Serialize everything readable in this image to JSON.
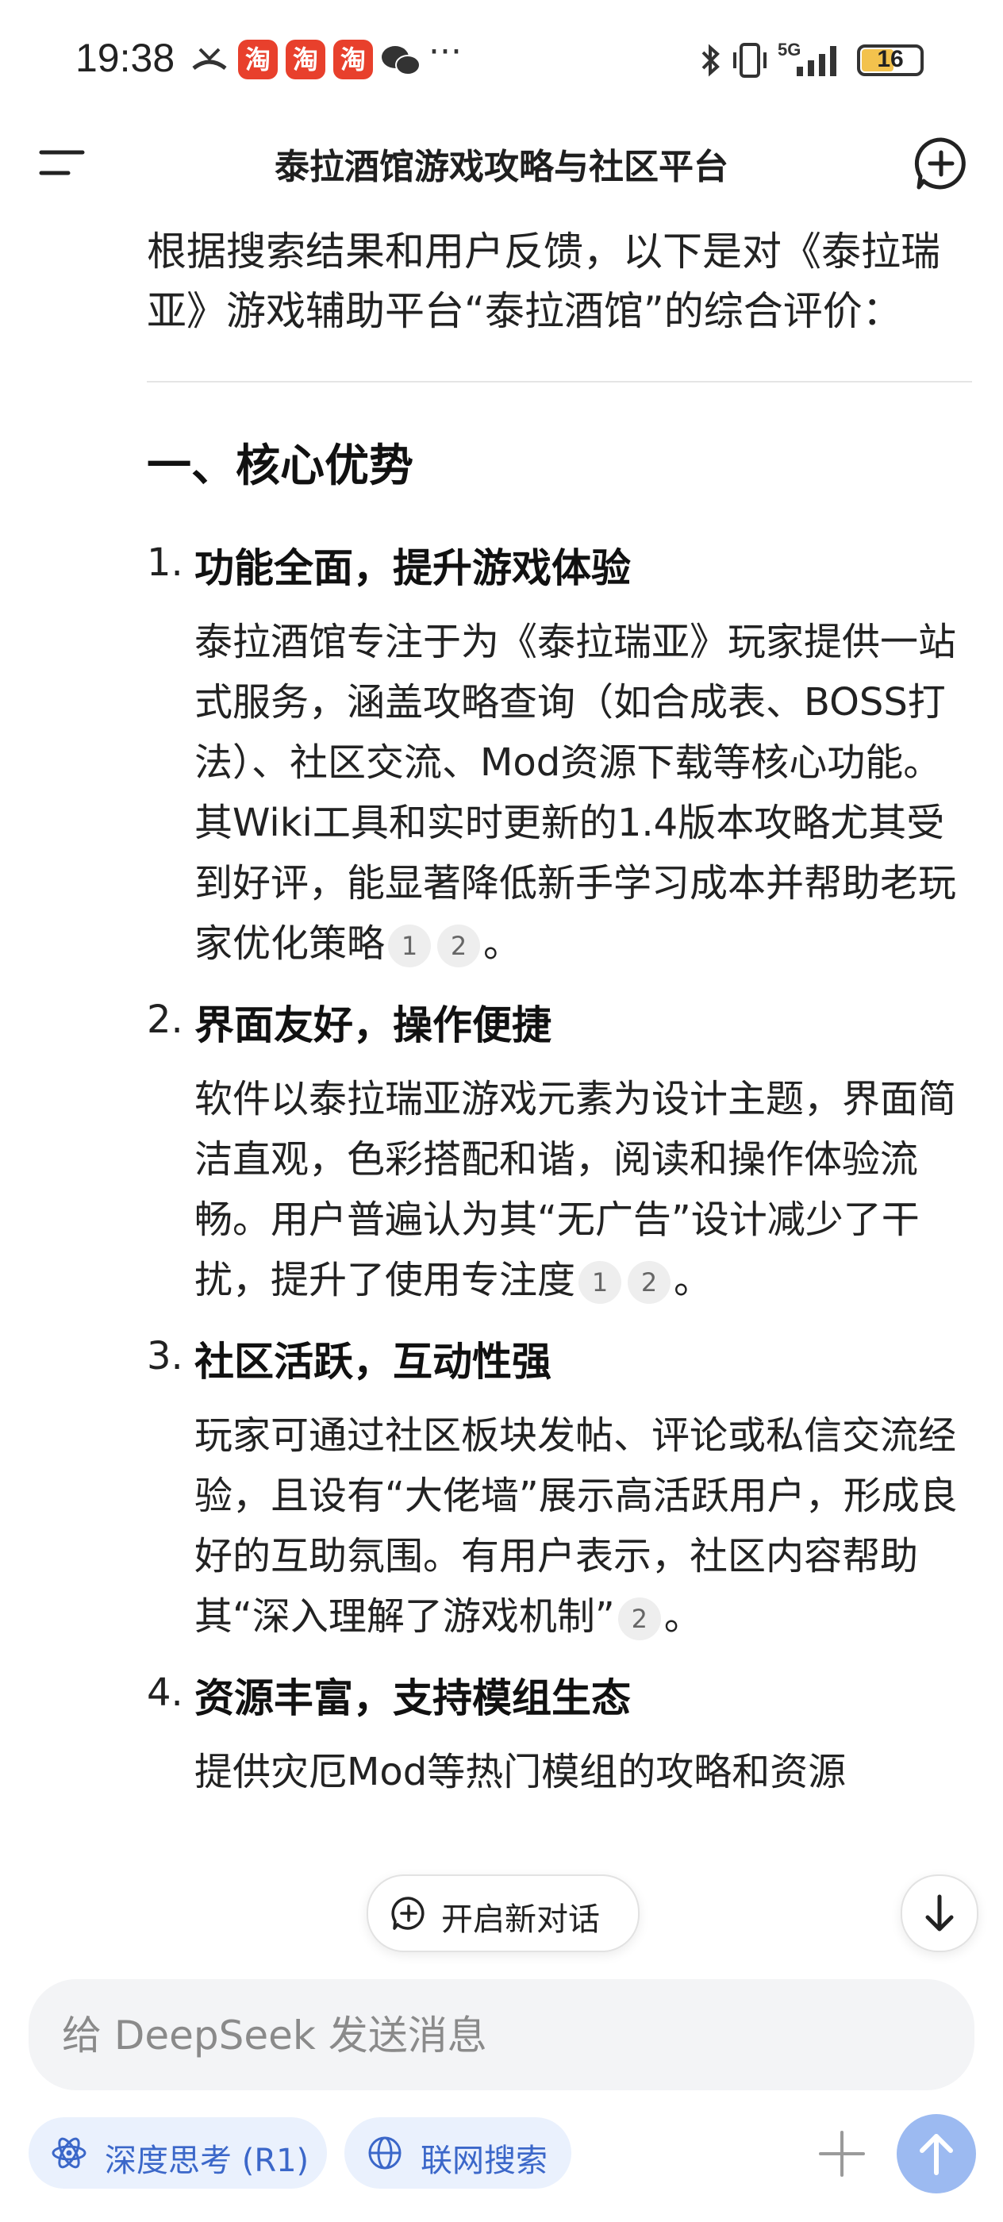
{
  "status_bar": {
    "time": "19:38",
    "taobao_glyph": "淘",
    "more": "···",
    "network": "5G",
    "battery": "16"
  },
  "header": {
    "title": "泰拉酒馆游戏攻略与社区平台"
  },
  "content": {
    "intro": "根据搜索结果和用户反馈，以下是对《泰拉瑞亚》游戏辅助平台“泰拉酒馆”的综合评价：",
    "section_title": "一、核心优势",
    "items": [
      {
        "num": "1.",
        "title": "功能全面，提升游戏体验",
        "body": "泰拉酒馆专注于为《泰拉瑞亚》玩家提供一站式服务，涵盖攻略查询（如合成表、BOSS打法）、社区交流、Mod资源下载等核心功能。其Wiki工具和实时更新的1.4版本攻略尤其受到好评，能显著降低新手学习成本并帮助老玩家优化策略",
        "cites": [
          "1",
          "2"
        ],
        "end": "。"
      },
      {
        "num": "2.",
        "title": "界面友好，操作便捷",
        "body": "软件以泰拉瑞亚游戏元素为设计主题，界面简洁直观，色彩搭配和谐，阅读和操作体验流畅。用户普遍认为其“无广告”设计减少了干扰，提升了使用专注度",
        "cites": [
          "1",
          "2"
        ],
        "end": "。"
      },
      {
        "num": "3.",
        "title": "社区活跃，互动性强",
        "body": "玩家可通过社区板块发帖、评论或私信交流经验，且设有“大佬墙”展示高活跃用户，形成良好的互助氛围。有用户表示，社区内容帮助其“深入理解了游戏机制”",
        "cites": [
          "2"
        ],
        "end": "。"
      },
      {
        "num": "4.",
        "title": "资源丰富，支持模组生态",
        "body": "提供灾厄Mod等热门模组的攻略和资源",
        "cites": [],
        "end": ""
      }
    ]
  },
  "floating": {
    "new_chat_label": "开启新对话"
  },
  "composer": {
    "placeholder": "给 DeepSeek 发送消息",
    "deep_think_label": "深度思考 (R1)",
    "web_search_label": "联网搜索"
  },
  "colors": {
    "accent": "#3b67c9",
    "chip_bg": "#eaf1fd",
    "send_bg": "#9cbaf1"
  }
}
